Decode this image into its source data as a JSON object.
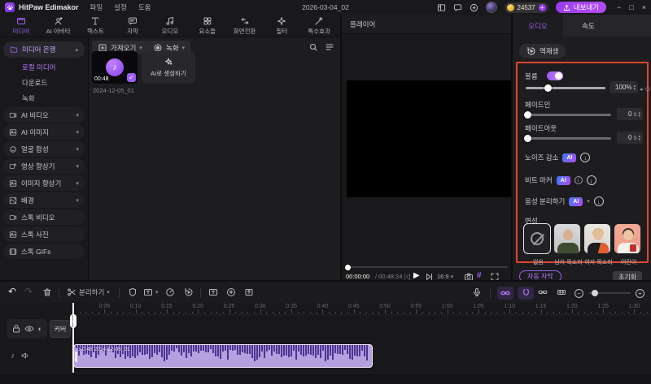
{
  "titlebar": {
    "app_name": "HitPaw Edimakor",
    "menus": [
      "파일",
      "설정",
      "도움"
    ],
    "date": "2026-03-04_02",
    "coins": "24537",
    "export_label": "내보내기"
  },
  "ribbon": {
    "tabs": [
      "미디어",
      "AI 아바타",
      "텍스트",
      "자막",
      "오디오",
      "요소들",
      "화면전환",
      "필터",
      "특수효과"
    ],
    "active": "미디어"
  },
  "sidebar": {
    "bank_label": "미디어 은행",
    "bank_items": [
      "로컬 미디어",
      "다운로드",
      "녹화"
    ],
    "active_item": "로컬 미디어",
    "groups": [
      "AI 비디오",
      "AI 이미지",
      "얼굴 합성",
      "영상 향상기",
      "이미지 향상기",
      "배경"
    ],
    "stock_items": [
      "스톡 비디오",
      "스톡 사진",
      "스톡 GIFs"
    ]
  },
  "media_panel": {
    "import_label": "가져오기",
    "record_label": "녹화",
    "clip": {
      "duration": "00:48",
      "name": "2024-12-05_01"
    },
    "ai_generate_label": "AI로 생성하기"
  },
  "player": {
    "title": "플레이어",
    "current_time": "00:00:00",
    "total_time": "/ 00:48:24",
    "ratio": "16:9"
  },
  "inspector": {
    "tabs": [
      "오디오",
      "속도"
    ],
    "active_tab": "오디오",
    "reverse_label": "역재생",
    "ai_badge": "AI",
    "volume": {
      "label": "볼륨",
      "value": "100%"
    },
    "fade_in": {
      "label": "페이드인",
      "value": "0",
      "unit": "s"
    },
    "fade_out": {
      "label": "페이드아웃",
      "value": "0",
      "unit": "s"
    },
    "noise_label": "노이즈 감소",
    "beat_label": "비트 마커",
    "voice_sep_label": "음성 분리하기",
    "voice_change": {
      "label": "변성",
      "options": [
        "없음",
        "남자 목소리",
        "여자 목소리",
        "어린이"
      ],
      "selected": "없음"
    },
    "auto_subtitle_label": "자동 자막",
    "reset_label": "초기화"
  },
  "tl_toolbar": {
    "split_label": "분리하기"
  },
  "timeline": {
    "cover_label": "커버",
    "ruler_labels": [
      "0:05",
      "0:10",
      "0:15",
      "0:20",
      "0:25",
      "0:30",
      "0:35",
      "0:40",
      "0:45",
      "0:50",
      "0:55",
      "1:00",
      "1:05",
      "1:10",
      "1:15",
      "1:20",
      "1:25",
      "1:30"
    ],
    "clip_label": "0:48 2024-12-05_01"
  },
  "colors": {
    "accent": "#a05cf5",
    "highlight_border": "#e0452e",
    "clip_fill": "#b3a1e0",
    "waveform": "#4a3492"
  }
}
